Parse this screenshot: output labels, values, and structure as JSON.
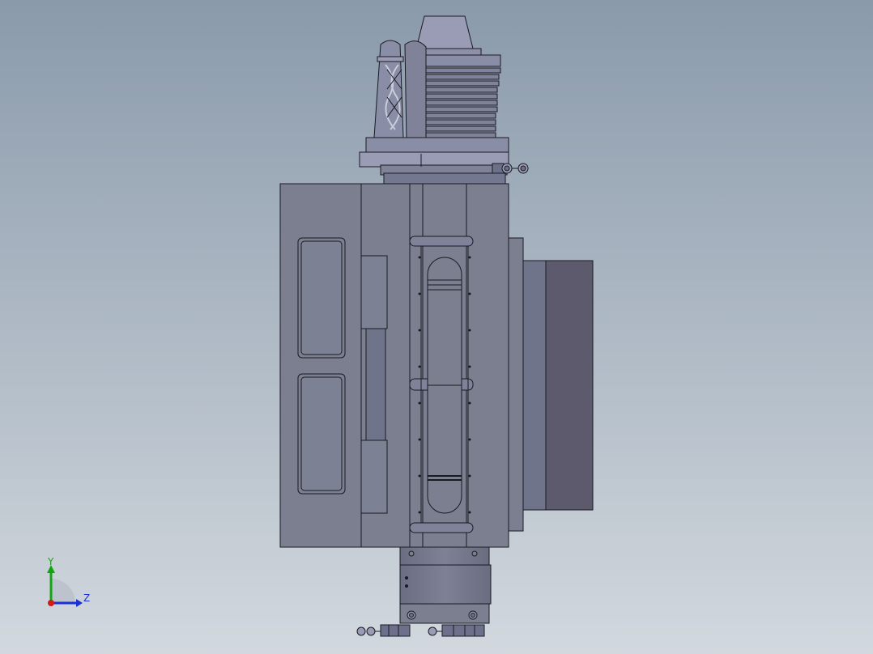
{
  "viewport": {
    "bg_top": "#8a9aab",
    "bg_bottom": "#d2d8de"
  },
  "model": {
    "face_light": "#7b7f90",
    "face_mid": "#70748a",
    "face_dark": "#5d5a6e",
    "face_top": "#9a9cb6",
    "edge": "#1a1a22"
  },
  "triad": {
    "y_label": "Y",
    "z_label": "Z",
    "y_color": "#13a313",
    "z_color": "#1b2fd6",
    "x_color": "#d11a1a"
  }
}
